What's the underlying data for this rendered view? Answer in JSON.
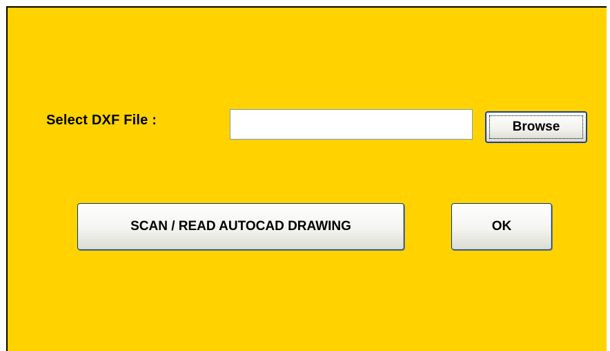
{
  "form": {
    "file_label": "Select DXF File :",
    "file_value": "",
    "file_placeholder": "",
    "browse_label": "Browse"
  },
  "actions": {
    "scan_label": "SCAN / READ AUTOCAD DRAWING",
    "ok_label": "OK"
  },
  "colors": {
    "panel_background": "#FFD200",
    "button_border": "#003c74",
    "focus_border": "#1c3f94"
  }
}
